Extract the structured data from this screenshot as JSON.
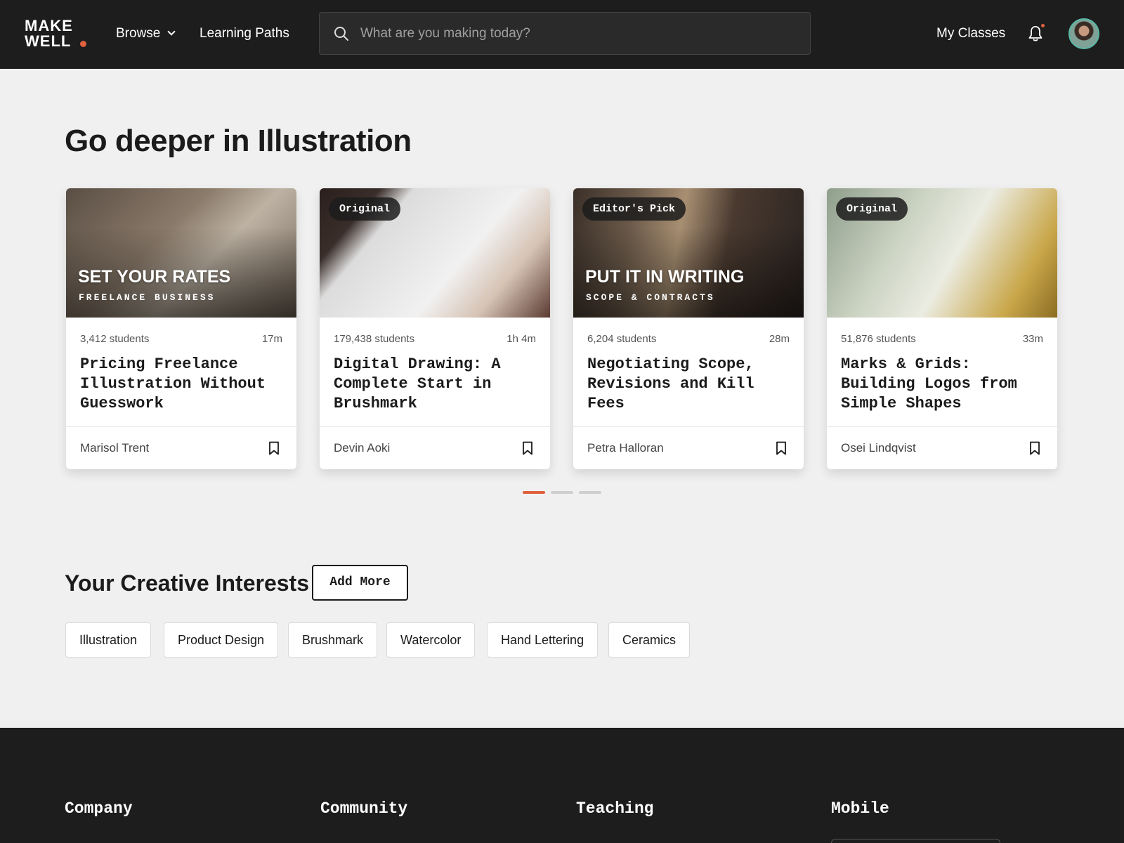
{
  "header": {
    "logo_line1": "MAKE",
    "logo_line2": "WELL",
    "nav": {
      "browse": "Browse",
      "learning_paths": "Learning Paths",
      "my_classes": "My Classes"
    },
    "search_placeholder": "What are you making today?",
    "icons": [
      "search-icon",
      "chevron-down-icon",
      "bell-icon",
      "avatar"
    ],
    "accent_color": "#e0613d"
  },
  "section_deeper": {
    "title": "Go deeper in Illustration",
    "cards": [
      {
        "badge": "",
        "overlay_title": "SET YOUR RATES",
        "overlay_sub": "FREELANCE BUSINESS",
        "students": "3,412 students",
        "duration": "17m",
        "title": "Pricing Freelance Illustration Without Guesswork",
        "author": "Marisol Trent"
      },
      {
        "badge": "Original",
        "overlay_title": "",
        "overlay_sub": "",
        "students": "179,438 students",
        "duration": "1h 4m",
        "title": "Digital Drawing: A Complete Start in Brushmark",
        "author": "Devin Aoki"
      },
      {
        "badge": "Editor's Pick",
        "overlay_title": "PUT IT IN WRITING",
        "overlay_sub": "SCOPE & CONTRACTS",
        "students": "6,204 students",
        "duration": "28m",
        "title": "Negotiating Scope, Revisions and Kill Fees",
        "author": "Petra Halloran"
      },
      {
        "badge": "Original",
        "overlay_title": "",
        "overlay_sub": "",
        "students": "51,876 students",
        "duration": "33m",
        "title": "Marks & Grids: Building Logos from Simple Shapes",
        "author": "Osei Lindqvist"
      }
    ],
    "carousel": {
      "pages": 3,
      "active_page": 1
    }
  },
  "section_interests": {
    "title": "Your Creative Interests",
    "add_more": "Add More",
    "chips": [
      "Illustration",
      "Product Design",
      "Brushmark",
      "Watercolor",
      "Hand Lettering",
      "Ceramics"
    ]
  },
  "footer": {
    "columns": [
      "Company",
      "Community",
      "Teaching",
      "Mobile"
    ]
  }
}
